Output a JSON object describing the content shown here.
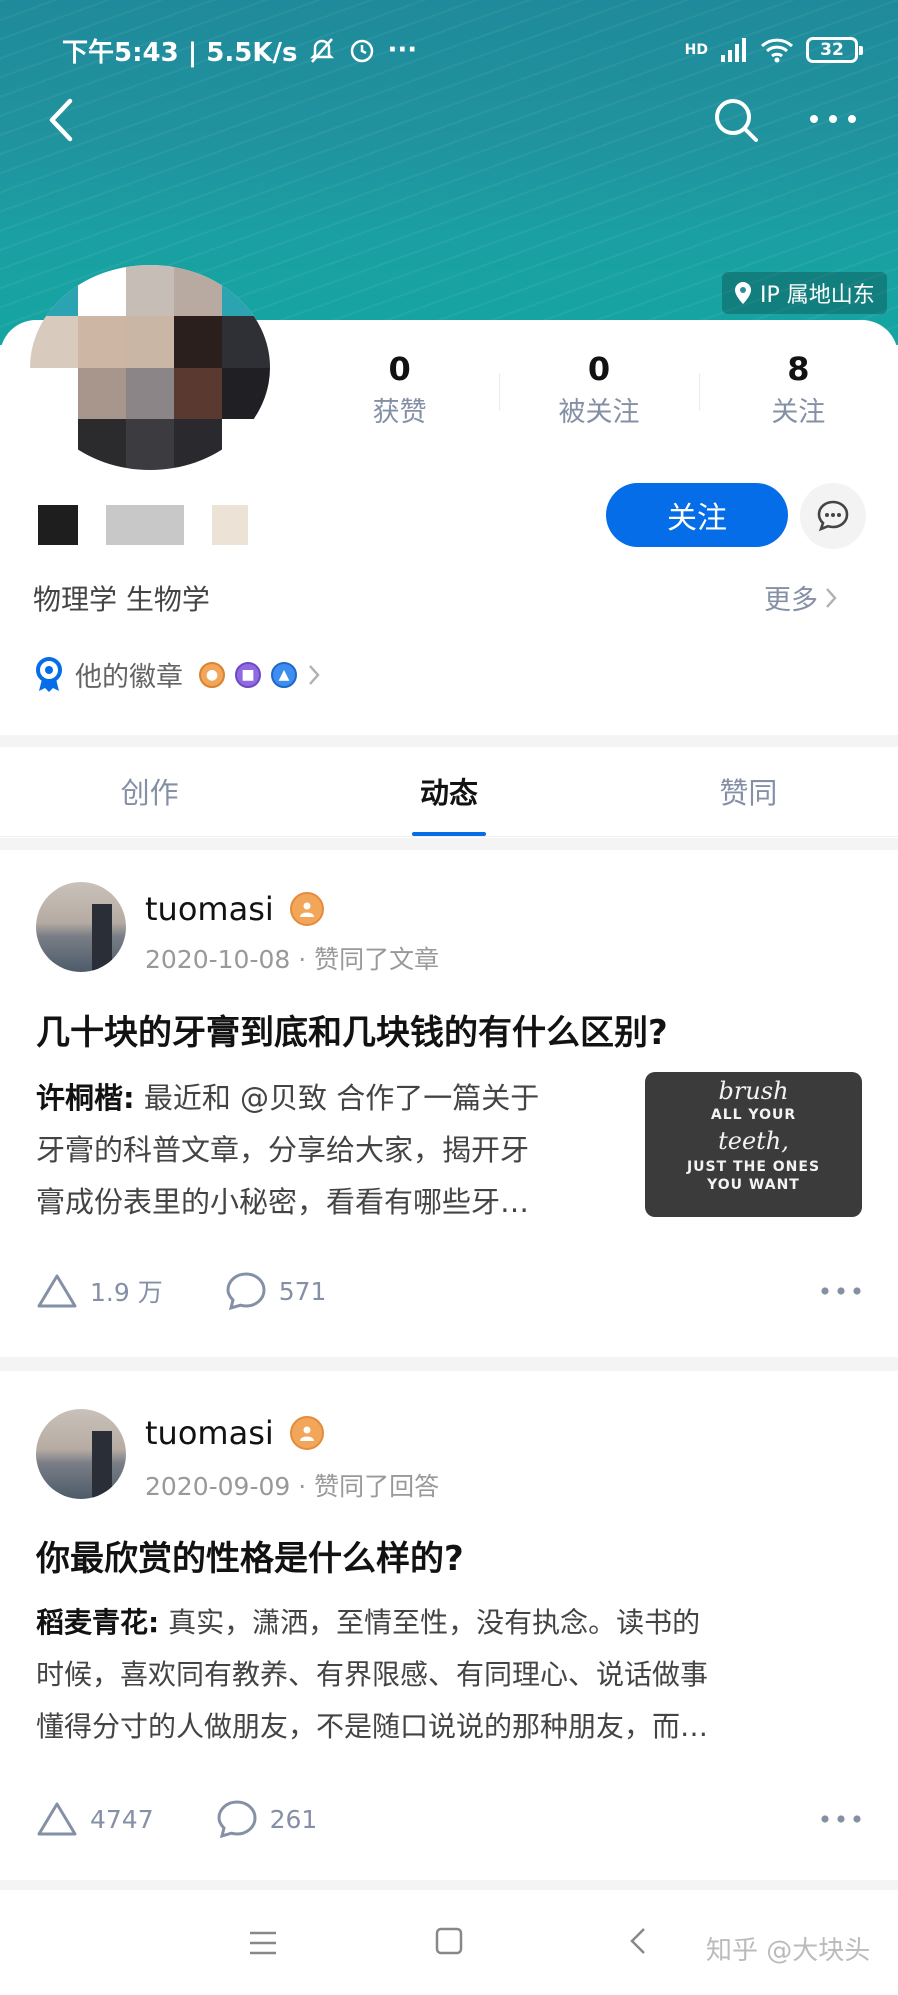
{
  "status_bar": {
    "time_speed": "下午5:43 | 5.5K/s",
    "more": "···",
    "network": "HD",
    "battery": "32"
  },
  "header": {
    "ip_location": "IP 属地山东"
  },
  "profile": {
    "stats": [
      {
        "value": "0",
        "label": "获赞"
      },
      {
        "value": "0",
        "label": "被关注"
      },
      {
        "value": "8",
        "label": "关注"
      }
    ],
    "follow_label": "关注",
    "bio": "物理学 生物学",
    "more_label": "更多",
    "badges_label": "他的徽章"
  },
  "tabs": [
    {
      "label": "创作",
      "active": false
    },
    {
      "label": "动态",
      "active": true
    },
    {
      "label": "赞同",
      "active": false
    }
  ],
  "feed": [
    {
      "user": "tuomasi",
      "date": "2020-10-08",
      "action": "赞同了文章",
      "title": "几十块的牙膏到底和几块钱的有什么区别?",
      "author": "许桐楷:",
      "excerpt_lines": [
        "最近和 @贝致 合作了一篇关于",
        "牙膏的科普文章，分享给大家，揭开牙",
        "膏成份表里的小秘密，看看有哪些牙…"
      ],
      "thumb_lines": [
        "brush",
        "ALL YOUR",
        "teeth,",
        "JUST THE ONES",
        "YOU WANT"
      ],
      "likes": "1.9 万",
      "comments": "571"
    },
    {
      "user": "tuomasi",
      "date": "2020-09-09",
      "action": "赞同了回答",
      "title": "你最欣赏的性格是什么样的?",
      "author": "稻麦青花:",
      "excerpt_lines": [
        "真实，潇洒，至情至性，没有执念。读书的",
        "时候，喜欢同有教养、有界限感、有同理心、说话做事",
        "懂得分寸的人做朋友，不是随口说说的那种朋友，而…"
      ],
      "likes": "4747",
      "comments": "261"
    }
  ],
  "watermark": "知乎 @大块头",
  "colors": {
    "accent": "#056de8",
    "banner": "#1f8a9b",
    "muted": "#8590a6",
    "badge_orange": "#f2a65a"
  }
}
